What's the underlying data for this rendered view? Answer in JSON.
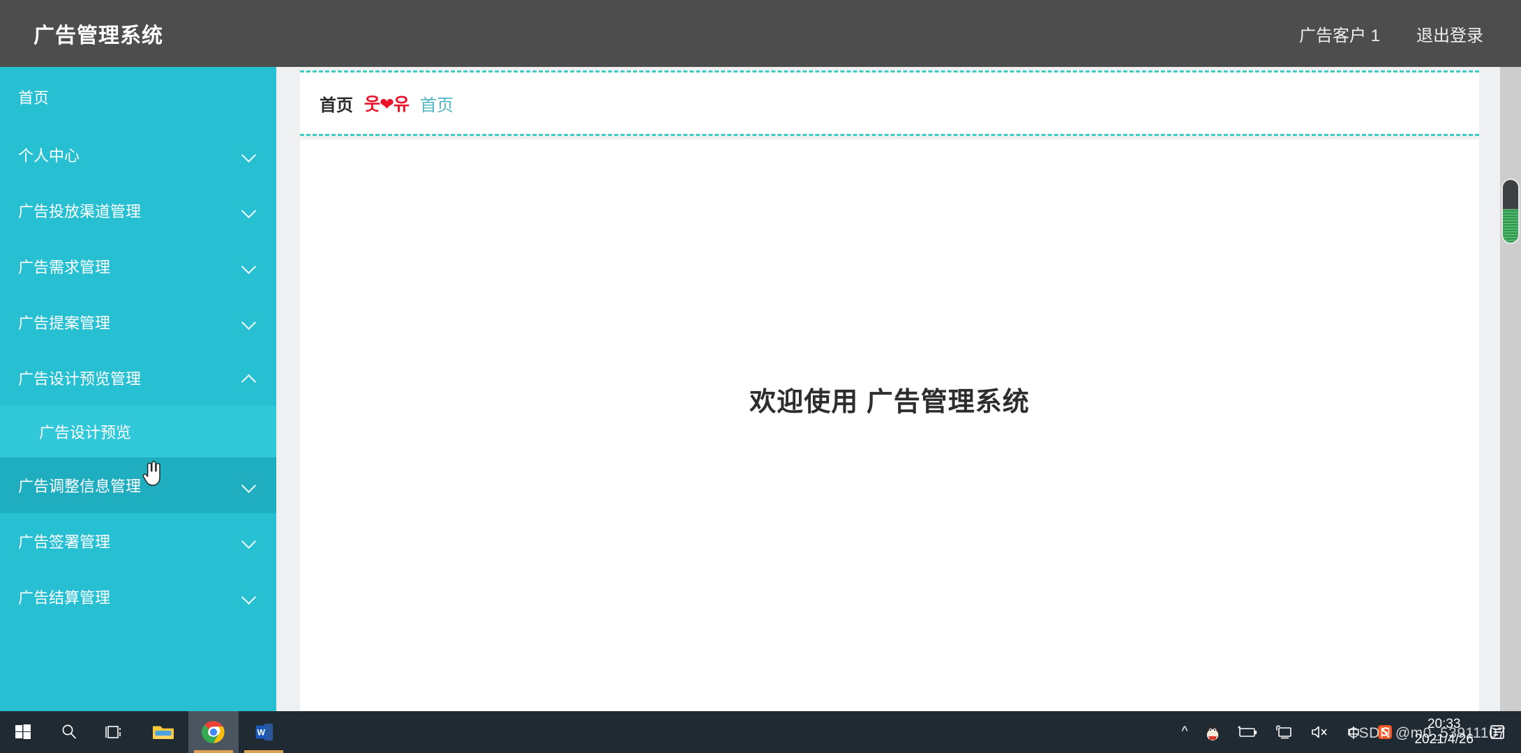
{
  "header": {
    "brand": "广告管理系统",
    "user": "广告客户 1",
    "logout": "退出登录"
  },
  "sidebar": {
    "items": [
      {
        "label": "首页",
        "icon": "none",
        "state": "normal",
        "level": 0
      },
      {
        "label": "个人中心",
        "icon": "chevron-down-icon",
        "state": "normal",
        "level": 0
      },
      {
        "label": "广告投放渠道管理",
        "icon": "chevron-down-icon",
        "state": "normal",
        "level": 0
      },
      {
        "label": "广告需求管理",
        "icon": "chevron-down-icon",
        "state": "normal",
        "level": 0
      },
      {
        "label": "广告提案管理",
        "icon": "chevron-down-icon",
        "state": "normal",
        "level": 0
      },
      {
        "label": "广告设计预览管理",
        "icon": "chevron-up-icon",
        "state": "expanded",
        "level": 0
      },
      {
        "label": "广告设计预览",
        "icon": "none",
        "state": "sub",
        "level": 1
      },
      {
        "label": "广告调整信息管理",
        "icon": "chevron-down-icon",
        "state": "hover",
        "level": 0
      },
      {
        "label": "广告签署管理",
        "icon": "chevron-down-icon",
        "state": "normal",
        "level": 0
      },
      {
        "label": "广告结算管理",
        "icon": "chevron-down-icon",
        "state": "normal",
        "level": 0
      }
    ]
  },
  "breadcrumb": {
    "root": "首页",
    "separator": "웃❤유",
    "current": "首页"
  },
  "main": {
    "welcome": "欢迎使用 广告管理系统"
  },
  "taskbar": {
    "buttons": [
      {
        "name": "start-button",
        "icon": "windows-logo-icon"
      },
      {
        "name": "search-button",
        "icon": "search-icon"
      },
      {
        "name": "task-view-button",
        "icon": "task-view-icon"
      },
      {
        "name": "file-explorer-button",
        "icon": "folder-icon"
      },
      {
        "name": "chrome-button",
        "icon": "chrome-icon"
      },
      {
        "name": "word-button",
        "icon": "word-icon"
      }
    ],
    "tray": {
      "overflow": "^",
      "ime": "中",
      "items": [
        "qq-icon",
        "battery-icon",
        "network-icon",
        "volume-muted-icon",
        "ime-icon",
        "sogou-icon"
      ]
    },
    "clock": {
      "time": "20:33",
      "date": "2021/4/26"
    }
  },
  "watermark": {
    "text": "CSDN @m0_53911107"
  },
  "colors": {
    "header_bg": "#4d4d4d",
    "sidebar_bg": "#27c0d3",
    "sidebar_sub_bg": "#31c9da",
    "sidebar_hover_bg": "#1fadc0",
    "accent_dashed": "#3ecbc0",
    "crumb_link": "#53b6c4",
    "crumb_heart": "#e8122b",
    "taskbar_bg": "#1f2a33"
  }
}
